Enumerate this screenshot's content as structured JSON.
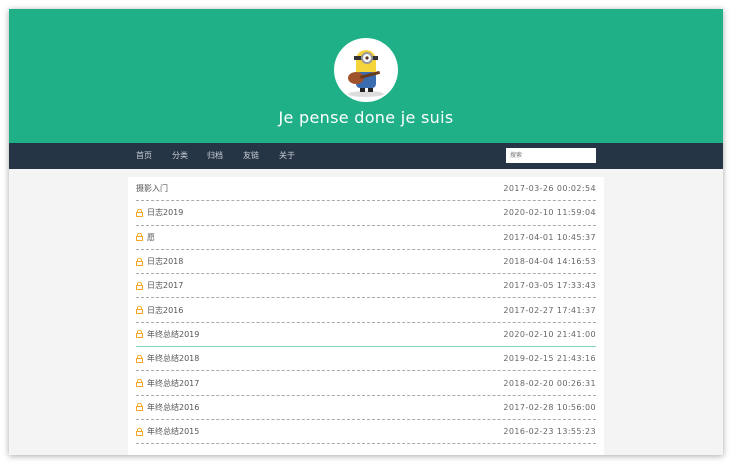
{
  "site_title": "Je pense done je suis",
  "nav": [
    "首页",
    "分类",
    "归档",
    "友链",
    "关于"
  ],
  "search_placeholder": "搜索",
  "colors": {
    "header": "#1fb087",
    "nav": "#263545",
    "lock": "#f5a623"
  },
  "posts": [
    {
      "title": "摄影入门",
      "date": "2017-03-26 00:02:54",
      "locked": false
    },
    {
      "title": "日志2019",
      "date": "2020-02-10 11:59:04",
      "locked": true
    },
    {
      "title": "愿",
      "date": "2017-04-01 10:45:37",
      "locked": true
    },
    {
      "title": "日志2018",
      "date": "2018-04-04 14:16:53",
      "locked": true
    },
    {
      "title": "日志2017",
      "date": "2017-03-05 17:33:43",
      "locked": true
    },
    {
      "title": "日志2016",
      "date": "2017-02-27 17:41:37",
      "locked": true
    },
    {
      "title": "年终总结2019",
      "date": "2020-02-10 21:41:00",
      "locked": true
    },
    {
      "title": "年终总结2018",
      "date": "2019-02-15 21:43:16",
      "locked": true
    },
    {
      "title": "年终总结2017",
      "date": "2018-02-20 00:26:31",
      "locked": true
    },
    {
      "title": "年终总结2016",
      "date": "2017-02-28 10:56:00",
      "locked": true
    },
    {
      "title": "年终总结2015",
      "date": "2016-02-23 13:55:23",
      "locked": true
    }
  ]
}
